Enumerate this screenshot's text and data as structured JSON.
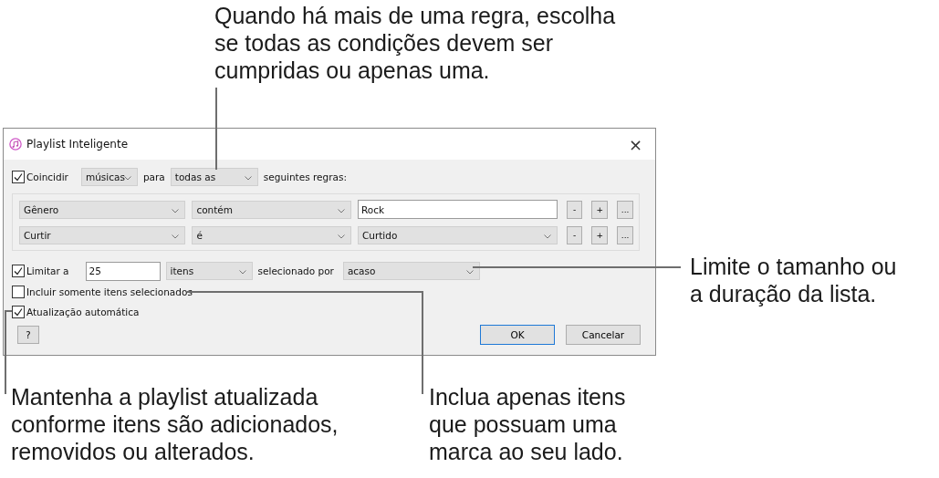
{
  "callouts": [
    {
      "kind": "top",
      "text": "Quando há mais de uma regra, escolha\nse todas as condições devem ser\ncumpridas ou apenas uma."
    },
    {
      "kind": "right",
      "text": "Limite o tamanho ou\na duração da lista."
    },
    {
      "kind": "bottom-left",
      "text": "Mantenha a playlist atualizada\nconforme itens são adicionados,\nremovidos ou alterados."
    },
    {
      "kind": "bottom-mid",
      "text": "Inclua apenas itens\nque possuam uma\nmarca ao seu lado."
    }
  ],
  "dialog": {
    "title": "Playlist Inteligente",
    "close": "×",
    "match": {
      "checked": true,
      "label": "Coincidir",
      "media": "músicas",
      "for_label": "para",
      "scope": "todas as",
      "suffix": "seguintes regras:"
    },
    "rules": [
      {
        "field": "Gênero",
        "operator": "contém",
        "kind": "text",
        "value": "Rock",
        "buttons": [
          "-",
          "+",
          "..."
        ]
      },
      {
        "field": "Curtir",
        "operator": "é",
        "kind": "select",
        "value": "Curtido",
        "buttons": [
          "-",
          "+",
          "..."
        ]
      }
    ],
    "limit": {
      "checked": true,
      "label": "Limitar a",
      "value": "25",
      "unit": "itens",
      "by_label": "selecionado por",
      "by": "acaso"
    },
    "only_checked": {
      "checked": false,
      "label": "Incluir somente itens selecionados"
    },
    "live_update": {
      "checked": true,
      "label": "Atualização automática"
    },
    "help": "?",
    "ok": "OK",
    "cancel": "Cancelar"
  }
}
